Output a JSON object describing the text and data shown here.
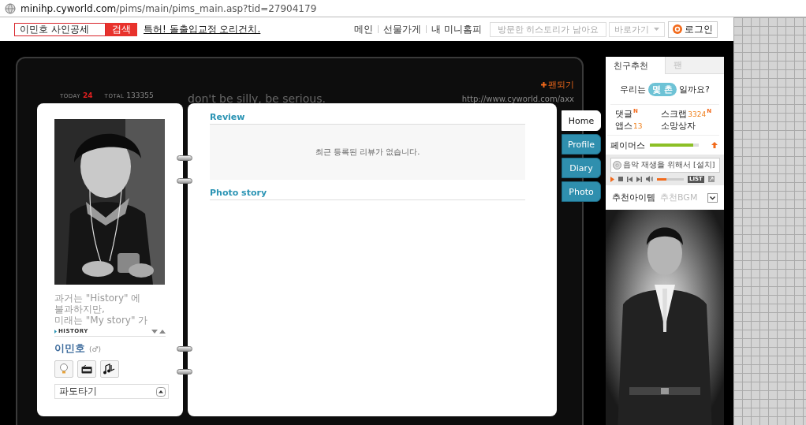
{
  "address_bar": {
    "host": "minihp.cyworld.com",
    "path": "/pims/main/pims_main.asp?tid=27904179"
  },
  "header": {
    "search": {
      "value": "이민호 사인공세",
      "button": "검색"
    },
    "promo_link": "특허! 돌출입교정 오리건치.",
    "nav": [
      "메인",
      "선물가게",
      "내 미니홈피"
    ],
    "history_box": "방문한 히스토리가 남아요",
    "shortcut": "바로가기",
    "login": "로그인"
  },
  "minihompy": {
    "today_label": "TODAY",
    "today": "24",
    "total_label": "TOTAL",
    "total": "133355",
    "title": "don't be silly, be serious.",
    "fan_button": "팬되기",
    "url": "http://www.cyworld.com/axx"
  },
  "profile": {
    "bio": [
      "과거는 \"History\" 에",
      "불과하지만,",
      "미래는 \"My story\" 가"
    ],
    "history_label": "HISTORY",
    "name": "이민호",
    "gender": "(♂)",
    "surf_select": "파도타기"
  },
  "content": {
    "sections": [
      {
        "title": "Review",
        "empty_message": "최근 등록된 리뷰가 없습니다."
      },
      {
        "title": "Photo story"
      }
    ]
  },
  "tabs": [
    {
      "label": "Home",
      "selected": true
    },
    {
      "label": "Profile",
      "selected": false
    },
    {
      "label": "Diary",
      "selected": false
    },
    {
      "label": "Photo",
      "selected": false
    }
  ],
  "side": {
    "tabs": [
      {
        "label": "친구추천",
        "selected": true
      },
      {
        "label": "팬",
        "selected": false
      }
    ],
    "chon": {
      "before": "우리는",
      "pill": "몇 촌",
      "after": "일까요?"
    },
    "stats": [
      {
        "label": "댓글",
        "badge": "N"
      },
      {
        "label": "스크랩",
        "count": "3324",
        "badge": "N"
      },
      {
        "label": "앱스",
        "count": "13"
      },
      {
        "label": "소망상자"
      }
    ],
    "famous": {
      "label": "페이머스",
      "level": 0.88
    },
    "player": {
      "message": "음악 재생을 위해서 [설치]",
      "volume": {
        "level": 0.35
      },
      "list_button": "LIST"
    },
    "recommend": [
      {
        "label": "추천아이템",
        "selected": true
      },
      {
        "label": "추천BGM",
        "selected": false
      }
    ]
  }
}
